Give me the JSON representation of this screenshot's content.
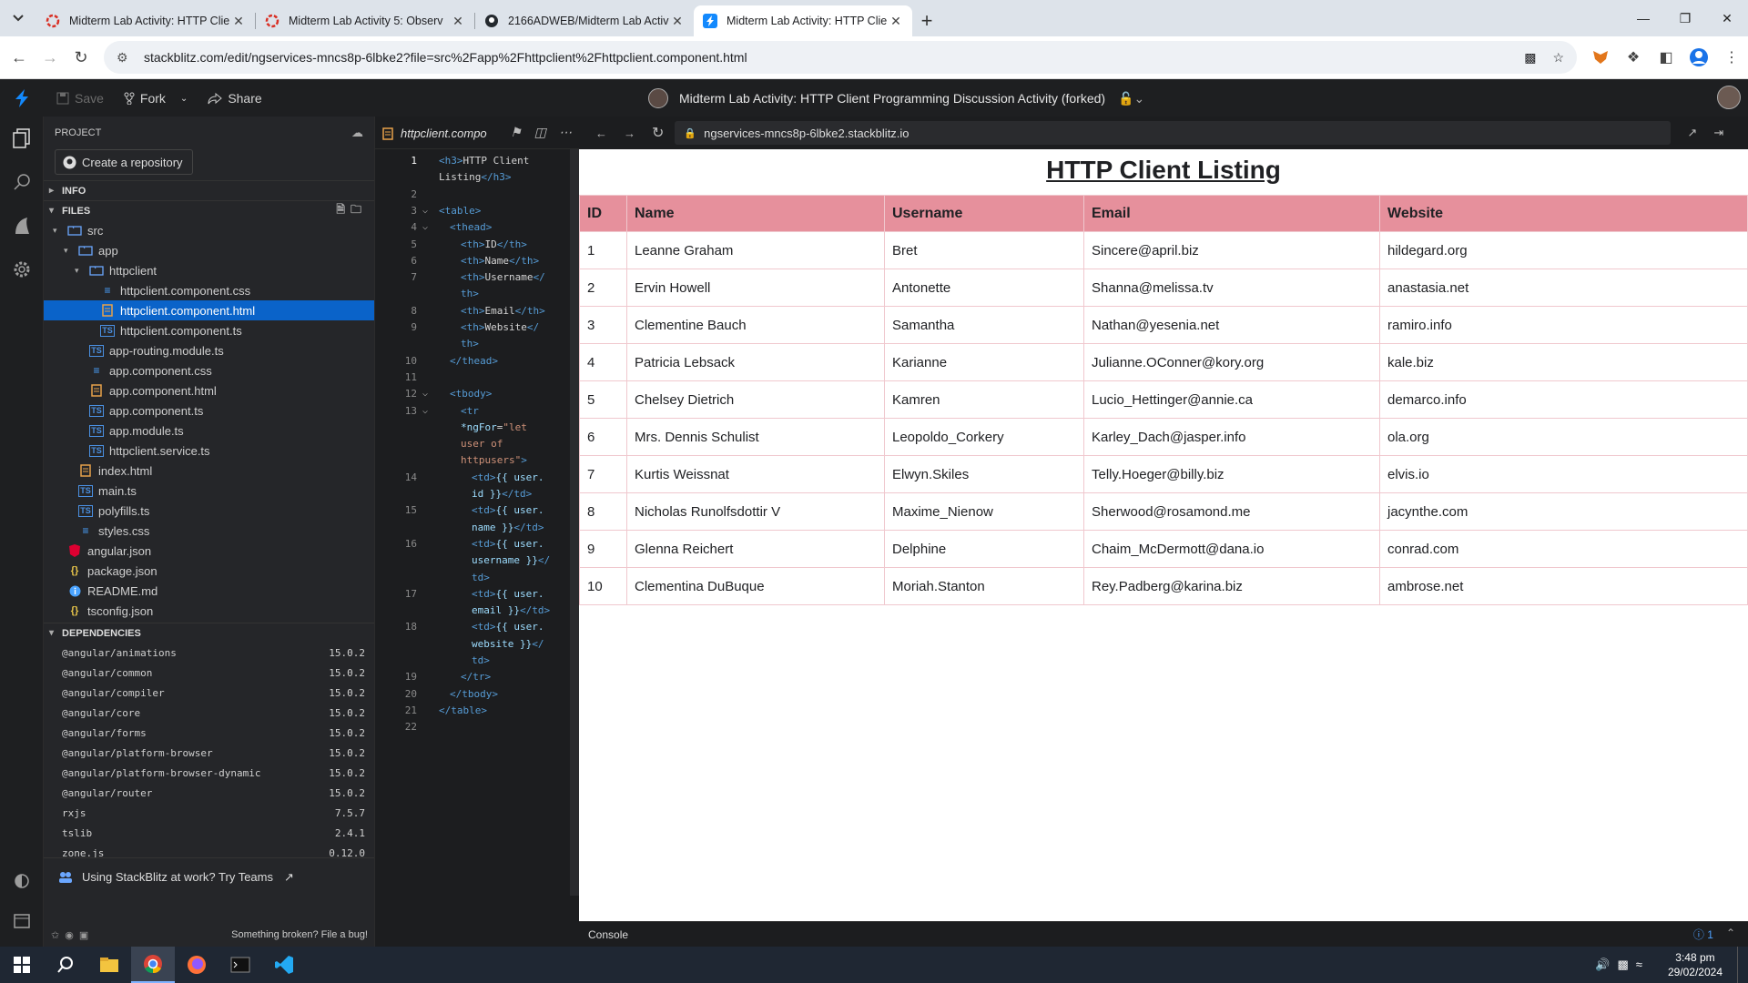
{
  "browser": {
    "tabs": [
      {
        "title": "Midterm Lab Activity: HTTP Clie",
        "favicon": "circle-dash-red-icon",
        "active": false
      },
      {
        "title": "Midterm Lab Activity 5: Observ",
        "favicon": "circle-dash-red-icon",
        "active": false
      },
      {
        "title": "2166ADWEB/Midterm Lab Activ",
        "favicon": "github-icon",
        "active": false
      },
      {
        "title": "Midterm Lab Activity: HTTP Clie",
        "favicon": "stackblitz-bolt-icon",
        "active": true
      }
    ],
    "url": "stackblitz.com/edit/ngservices-mncs8p-6lbke2?file=src%2Fapp%2Fhttpclient%2Fhttpclient.component.html"
  },
  "stackblitz": {
    "save_label": "Save",
    "fork_label": "Fork",
    "share_label": "Share",
    "project_title": "Midterm Lab Activity: HTTP Client Programming Discussion Activity (forked)",
    "accent": "#1389fd"
  },
  "project_panel": {
    "header": "PROJECT",
    "create_repo_label": "Create a repository",
    "info_label": "INFO",
    "files_label": "FILES",
    "files": [
      {
        "name": "src",
        "kind": "folder",
        "depth": 0
      },
      {
        "name": "app",
        "kind": "folder",
        "depth": 1
      },
      {
        "name": "httpclient",
        "kind": "folder",
        "depth": 2
      },
      {
        "name": "httpclient.component.css",
        "kind": "css",
        "depth": 3
      },
      {
        "name": "httpclient.component.html",
        "kind": "html",
        "depth": 3,
        "selected": true
      },
      {
        "name": "httpclient.component.ts",
        "kind": "ts",
        "depth": 3
      },
      {
        "name": "app-routing.module.ts",
        "kind": "ts",
        "depth": 2
      },
      {
        "name": "app.component.css",
        "kind": "css",
        "depth": 2
      },
      {
        "name": "app.component.html",
        "kind": "html",
        "depth": 2
      },
      {
        "name": "app.component.ts",
        "kind": "ts",
        "depth": 2
      },
      {
        "name": "app.module.ts",
        "kind": "ts",
        "depth": 2
      },
      {
        "name": "httpclient.service.ts",
        "kind": "ts",
        "depth": 2
      },
      {
        "name": "index.html",
        "kind": "html",
        "depth": 1
      },
      {
        "name": "main.ts",
        "kind": "ts",
        "depth": 1
      },
      {
        "name": "polyfills.ts",
        "kind": "ts",
        "depth": 1
      },
      {
        "name": "styles.css",
        "kind": "css",
        "depth": 1
      },
      {
        "name": "angular.json",
        "kind": "angular",
        "depth": 0
      },
      {
        "name": "package.json",
        "kind": "json",
        "depth": 0
      },
      {
        "name": "README.md",
        "kind": "info",
        "depth": 0
      },
      {
        "name": "tsconfig.json",
        "kind": "json",
        "depth": 0
      }
    ],
    "dependencies_label": "DEPENDENCIES",
    "dependencies": [
      {
        "name": "@angular/animations",
        "version": "15.0.2"
      },
      {
        "name": "@angular/common",
        "version": "15.0.2"
      },
      {
        "name": "@angular/compiler",
        "version": "15.0.2"
      },
      {
        "name": "@angular/core",
        "version": "15.0.2"
      },
      {
        "name": "@angular/forms",
        "version": "15.0.2"
      },
      {
        "name": "@angular/platform-browser",
        "version": "15.0.2"
      },
      {
        "name": "@angular/platform-browser-dynamic",
        "version": "15.0.2"
      },
      {
        "name": "@angular/router",
        "version": "15.0.2"
      },
      {
        "name": "rxjs",
        "version": "7.5.7"
      },
      {
        "name": "tslib",
        "version": "2.4.1"
      },
      {
        "name": "zone.js",
        "version": "0.12.0"
      }
    ],
    "teams_label": "Using StackBlitz at work? Try Teams",
    "broken_label": "Something broken? File a bug!"
  },
  "editor": {
    "tab_label": "httpclient.compo",
    "code_lines": [
      {
        "n": "1",
        "y": 0,
        "indent": 0,
        "html": "<span class='tag'>&lt;h3&gt;</span><span class='txt'>HTTP Client</span>"
      },
      {
        "n": "",
        "y": 1,
        "indent": 0,
        "html": "<span class='txt'>Listing</span><span class='tag'>&lt;/h3&gt;</span>"
      },
      {
        "n": "2",
        "y": 2,
        "indent": 0,
        "html": ""
      },
      {
        "n": "3",
        "y": 3,
        "indent": 0,
        "html": "<span class='tag'>&lt;table&gt;</span>",
        "fold": true
      },
      {
        "n": "4",
        "y": 4,
        "indent": 1,
        "html": "<span class='tag'>&lt;thead&gt;</span>",
        "fold": true
      },
      {
        "n": "5",
        "y": 5,
        "indent": 2,
        "html": "<span class='tag'>&lt;th&gt;</span><span class='txt'>ID</span><span class='tag'>&lt;/th&gt;</span>"
      },
      {
        "n": "6",
        "y": 6,
        "indent": 2,
        "html": "<span class='tag'>&lt;th&gt;</span><span class='txt'>Name</span><span class='tag'>&lt;/th&gt;</span>"
      },
      {
        "n": "7",
        "y": 7,
        "indent": 2,
        "html": "<span class='tag'>&lt;th&gt;</span><span class='txt'>Username</span><span class='tag'>&lt;/</span>"
      },
      {
        "n": "",
        "y": 8,
        "indent": 2,
        "html": "<span class='tag'>th&gt;</span>"
      },
      {
        "n": "8",
        "y": 9,
        "indent": 2,
        "html": "<span class='tag'>&lt;th&gt;</span><span class='txt'>Email</span><span class='tag'>&lt;/th&gt;</span>"
      },
      {
        "n": "9",
        "y": 10,
        "indent": 2,
        "html": "<span class='tag'>&lt;th&gt;</span><span class='txt'>Website</span><span class='tag'>&lt;/</span>"
      },
      {
        "n": "",
        "y": 11,
        "indent": 2,
        "html": "<span class='tag'>th&gt;</span>"
      },
      {
        "n": "10",
        "y": 12,
        "indent": 1,
        "html": "<span class='tag'>&lt;/thead&gt;</span>"
      },
      {
        "n": "11",
        "y": 13,
        "indent": 0,
        "html": ""
      },
      {
        "n": "12",
        "y": 14,
        "indent": 1,
        "html": "<span class='tag'>&lt;tbody&gt;</span>",
        "fold": true
      },
      {
        "n": "13",
        "y": 15,
        "indent": 2,
        "html": "<span class='tag'>&lt;tr</span>",
        "fold": true
      },
      {
        "n": "",
        "y": 16,
        "indent": 2,
        "html": "<span class='attr'>*ngFor</span><span class='txt'>=</span><span class='str'>\"let</span>"
      },
      {
        "n": "",
        "y": 17,
        "indent": 2,
        "html": "<span class='str'>user of</span>"
      },
      {
        "n": "",
        "y": 18,
        "indent": 2,
        "html": "<span class='str'>httpusers\"</span><span class='tag'>&gt;</span>"
      },
      {
        "n": "14",
        "y": 19,
        "indent": 3,
        "html": "<span class='tag'>&lt;td&gt;</span><span class='attr'>{{ user.</span>"
      },
      {
        "n": "",
        "y": 20,
        "indent": 3,
        "html": "<span class='attr'>id }}</span><span class='tag'>&lt;/td&gt;</span>"
      },
      {
        "n": "15",
        "y": 21,
        "indent": 3,
        "html": "<span class='tag'>&lt;td&gt;</span><span class='attr'>{{ user.</span>"
      },
      {
        "n": "",
        "y": 22,
        "indent": 3,
        "html": "<span class='attr'>name }}</span><span class='tag'>&lt;/td&gt;</span>"
      },
      {
        "n": "16",
        "y": 23,
        "indent": 3,
        "html": "<span class='tag'>&lt;td&gt;</span><span class='attr'>{{ user.</span>"
      },
      {
        "n": "",
        "y": 24,
        "indent": 3,
        "html": "<span class='attr'>username }}</span><span class='tag'>&lt;/</span>"
      },
      {
        "n": "",
        "y": 25,
        "indent": 3,
        "html": "<span class='tag'>td&gt;</span>"
      },
      {
        "n": "17",
        "y": 26,
        "indent": 3,
        "html": "<span class='tag'>&lt;td&gt;</span><span class='attr'>{{ user.</span>"
      },
      {
        "n": "",
        "y": 27,
        "indent": 3,
        "html": "<span class='attr'>email }}</span><span class='tag'>&lt;/td&gt;</span>"
      },
      {
        "n": "18",
        "y": 28,
        "indent": 3,
        "html": "<span class='tag'>&lt;td&gt;</span><span class='attr'>{{ user.</span>"
      },
      {
        "n": "",
        "y": 29,
        "indent": 3,
        "html": "<span class='attr'>website }}</span><span class='tag'>&lt;/</span>"
      },
      {
        "n": "",
        "y": 30,
        "indent": 3,
        "html": "<span class='tag'>td&gt;</span>"
      },
      {
        "n": "19",
        "y": 31,
        "indent": 2,
        "html": "<span class='tag'>&lt;/tr&gt;</span>"
      },
      {
        "n": "20",
        "y": 32,
        "indent": 1,
        "html": "<span class='tag'>&lt;/tbody&gt;</span>"
      },
      {
        "n": "21",
        "y": 33,
        "indent": 0,
        "html": "<span class='tag'>&lt;/table&gt;</span>"
      },
      {
        "n": "22",
        "y": 34,
        "indent": 0,
        "html": ""
      }
    ]
  },
  "preview": {
    "url": "ngservices-mncs8p-6lbke2.stackblitz.io",
    "heading": "HTTP Client Listing",
    "header_color": "#e6909c",
    "columns": [
      "ID",
      "Name",
      "Username",
      "Email",
      "Website"
    ],
    "rows": [
      [
        "1",
        "Leanne Graham",
        "Bret",
        "Sincere@april.biz",
        "hildegard.org"
      ],
      [
        "2",
        "Ervin Howell",
        "Antonette",
        "Shanna@melissa.tv",
        "anastasia.net"
      ],
      [
        "3",
        "Clementine Bauch",
        "Samantha",
        "Nathan@yesenia.net",
        "ramiro.info"
      ],
      [
        "4",
        "Patricia Lebsack",
        "Karianne",
        "Julianne.OConner@kory.org",
        "kale.biz"
      ],
      [
        "5",
        "Chelsey Dietrich",
        "Kamren",
        "Lucio_Hettinger@annie.ca",
        "demarco.info"
      ],
      [
        "6",
        "Mrs. Dennis Schulist",
        "Leopoldo_Corkery",
        "Karley_Dach@jasper.info",
        "ola.org"
      ],
      [
        "7",
        "Kurtis Weissnat",
        "Elwyn.Skiles",
        "Telly.Hoeger@billy.biz",
        "elvis.io"
      ],
      [
        "8",
        "Nicholas Runolfsdottir V",
        "Maxime_Nienow",
        "Sherwood@rosamond.me",
        "jacynthe.com"
      ],
      [
        "9",
        "Glenna Reichert",
        "Delphine",
        "Chaim_McDermott@dana.io",
        "conrad.com"
      ],
      [
        "10",
        "Clementina DuBuque",
        "Moriah.Stanton",
        "Rey.Padberg@karina.biz",
        "ambrose.net"
      ]
    ]
  },
  "console": {
    "label": "Console",
    "count": "1"
  },
  "taskbar": {
    "time": "3:48 pm",
    "date": "29/02/2024"
  }
}
